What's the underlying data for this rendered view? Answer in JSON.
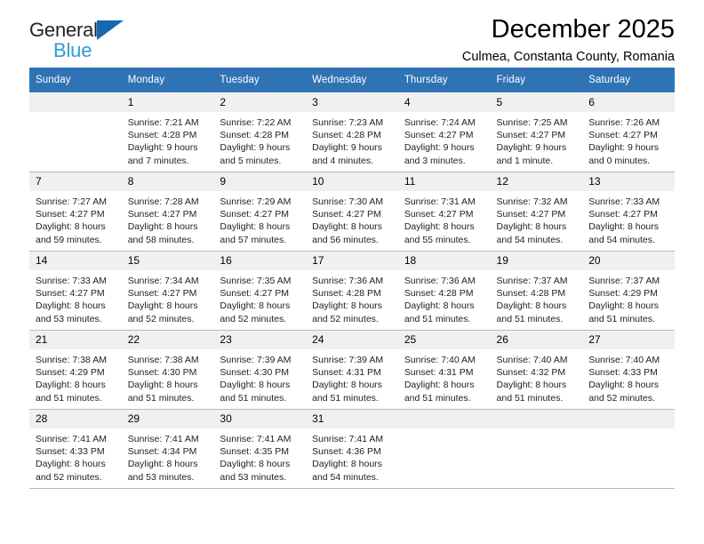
{
  "brand": {
    "line1": "General",
    "line2": "Blue",
    "logo_icon": "triangle-logo-icon"
  },
  "header": {
    "title": "December 2025",
    "subtitle": "Culmea, Constanta County, Romania"
  },
  "calendar": {
    "weekday_headers": [
      "Sunday",
      "Monday",
      "Tuesday",
      "Wednesday",
      "Thursday",
      "Friday",
      "Saturday"
    ],
    "accent_color": "#3073b4",
    "daynum_background": "#f0f0f0",
    "weeks": [
      [
        {
          "day": "",
          "blank": true
        },
        {
          "day": "1",
          "sunrise": "Sunrise: 7:21 AM",
          "sunset": "Sunset: 4:28 PM",
          "daylight1": "Daylight: 9 hours",
          "daylight2": "and 7 minutes."
        },
        {
          "day": "2",
          "sunrise": "Sunrise: 7:22 AM",
          "sunset": "Sunset: 4:28 PM",
          "daylight1": "Daylight: 9 hours",
          "daylight2": "and 5 minutes."
        },
        {
          "day": "3",
          "sunrise": "Sunrise: 7:23 AM",
          "sunset": "Sunset: 4:28 PM",
          "daylight1": "Daylight: 9 hours",
          "daylight2": "and 4 minutes."
        },
        {
          "day": "4",
          "sunrise": "Sunrise: 7:24 AM",
          "sunset": "Sunset: 4:27 PM",
          "daylight1": "Daylight: 9 hours",
          "daylight2": "and 3 minutes."
        },
        {
          "day": "5",
          "sunrise": "Sunrise: 7:25 AM",
          "sunset": "Sunset: 4:27 PM",
          "daylight1": "Daylight: 9 hours",
          "daylight2": "and 1 minute."
        },
        {
          "day": "6",
          "sunrise": "Sunrise: 7:26 AM",
          "sunset": "Sunset: 4:27 PM",
          "daylight1": "Daylight: 9 hours",
          "daylight2": "and 0 minutes."
        }
      ],
      [
        {
          "day": "7",
          "sunrise": "Sunrise: 7:27 AM",
          "sunset": "Sunset: 4:27 PM",
          "daylight1": "Daylight: 8 hours",
          "daylight2": "and 59 minutes."
        },
        {
          "day": "8",
          "sunrise": "Sunrise: 7:28 AM",
          "sunset": "Sunset: 4:27 PM",
          "daylight1": "Daylight: 8 hours",
          "daylight2": "and 58 minutes."
        },
        {
          "day": "9",
          "sunrise": "Sunrise: 7:29 AM",
          "sunset": "Sunset: 4:27 PM",
          "daylight1": "Daylight: 8 hours",
          "daylight2": "and 57 minutes."
        },
        {
          "day": "10",
          "sunrise": "Sunrise: 7:30 AM",
          "sunset": "Sunset: 4:27 PM",
          "daylight1": "Daylight: 8 hours",
          "daylight2": "and 56 minutes."
        },
        {
          "day": "11",
          "sunrise": "Sunrise: 7:31 AM",
          "sunset": "Sunset: 4:27 PM",
          "daylight1": "Daylight: 8 hours",
          "daylight2": "and 55 minutes."
        },
        {
          "day": "12",
          "sunrise": "Sunrise: 7:32 AM",
          "sunset": "Sunset: 4:27 PM",
          "daylight1": "Daylight: 8 hours",
          "daylight2": "and 54 minutes."
        },
        {
          "day": "13",
          "sunrise": "Sunrise: 7:33 AM",
          "sunset": "Sunset: 4:27 PM",
          "daylight1": "Daylight: 8 hours",
          "daylight2": "and 54 minutes."
        }
      ],
      [
        {
          "day": "14",
          "sunrise": "Sunrise: 7:33 AM",
          "sunset": "Sunset: 4:27 PM",
          "daylight1": "Daylight: 8 hours",
          "daylight2": "and 53 minutes."
        },
        {
          "day": "15",
          "sunrise": "Sunrise: 7:34 AM",
          "sunset": "Sunset: 4:27 PM",
          "daylight1": "Daylight: 8 hours",
          "daylight2": "and 52 minutes."
        },
        {
          "day": "16",
          "sunrise": "Sunrise: 7:35 AM",
          "sunset": "Sunset: 4:27 PM",
          "daylight1": "Daylight: 8 hours",
          "daylight2": "and 52 minutes."
        },
        {
          "day": "17",
          "sunrise": "Sunrise: 7:36 AM",
          "sunset": "Sunset: 4:28 PM",
          "daylight1": "Daylight: 8 hours",
          "daylight2": "and 52 minutes."
        },
        {
          "day": "18",
          "sunrise": "Sunrise: 7:36 AM",
          "sunset": "Sunset: 4:28 PM",
          "daylight1": "Daylight: 8 hours",
          "daylight2": "and 51 minutes."
        },
        {
          "day": "19",
          "sunrise": "Sunrise: 7:37 AM",
          "sunset": "Sunset: 4:28 PM",
          "daylight1": "Daylight: 8 hours",
          "daylight2": "and 51 minutes."
        },
        {
          "day": "20",
          "sunrise": "Sunrise: 7:37 AM",
          "sunset": "Sunset: 4:29 PM",
          "daylight1": "Daylight: 8 hours",
          "daylight2": "and 51 minutes."
        }
      ],
      [
        {
          "day": "21",
          "sunrise": "Sunrise: 7:38 AM",
          "sunset": "Sunset: 4:29 PM",
          "daylight1": "Daylight: 8 hours",
          "daylight2": "and 51 minutes."
        },
        {
          "day": "22",
          "sunrise": "Sunrise: 7:38 AM",
          "sunset": "Sunset: 4:30 PM",
          "daylight1": "Daylight: 8 hours",
          "daylight2": "and 51 minutes."
        },
        {
          "day": "23",
          "sunrise": "Sunrise: 7:39 AM",
          "sunset": "Sunset: 4:30 PM",
          "daylight1": "Daylight: 8 hours",
          "daylight2": "and 51 minutes."
        },
        {
          "day": "24",
          "sunrise": "Sunrise: 7:39 AM",
          "sunset": "Sunset: 4:31 PM",
          "daylight1": "Daylight: 8 hours",
          "daylight2": "and 51 minutes."
        },
        {
          "day": "25",
          "sunrise": "Sunrise: 7:40 AM",
          "sunset": "Sunset: 4:31 PM",
          "daylight1": "Daylight: 8 hours",
          "daylight2": "and 51 minutes."
        },
        {
          "day": "26",
          "sunrise": "Sunrise: 7:40 AM",
          "sunset": "Sunset: 4:32 PM",
          "daylight1": "Daylight: 8 hours",
          "daylight2": "and 51 minutes."
        },
        {
          "day": "27",
          "sunrise": "Sunrise: 7:40 AM",
          "sunset": "Sunset: 4:33 PM",
          "daylight1": "Daylight: 8 hours",
          "daylight2": "and 52 minutes."
        }
      ],
      [
        {
          "day": "28",
          "sunrise": "Sunrise: 7:41 AM",
          "sunset": "Sunset: 4:33 PM",
          "daylight1": "Daylight: 8 hours",
          "daylight2": "and 52 minutes."
        },
        {
          "day": "29",
          "sunrise": "Sunrise: 7:41 AM",
          "sunset": "Sunset: 4:34 PM",
          "daylight1": "Daylight: 8 hours",
          "daylight2": "and 53 minutes."
        },
        {
          "day": "30",
          "sunrise": "Sunrise: 7:41 AM",
          "sunset": "Sunset: 4:35 PM",
          "daylight1": "Daylight: 8 hours",
          "daylight2": "and 53 minutes."
        },
        {
          "day": "31",
          "sunrise": "Sunrise: 7:41 AM",
          "sunset": "Sunset: 4:36 PM",
          "daylight1": "Daylight: 8 hours",
          "daylight2": "and 54 minutes."
        },
        {
          "day": "",
          "blank": true
        },
        {
          "day": "",
          "blank": true
        },
        {
          "day": "",
          "blank": true
        }
      ]
    ]
  }
}
